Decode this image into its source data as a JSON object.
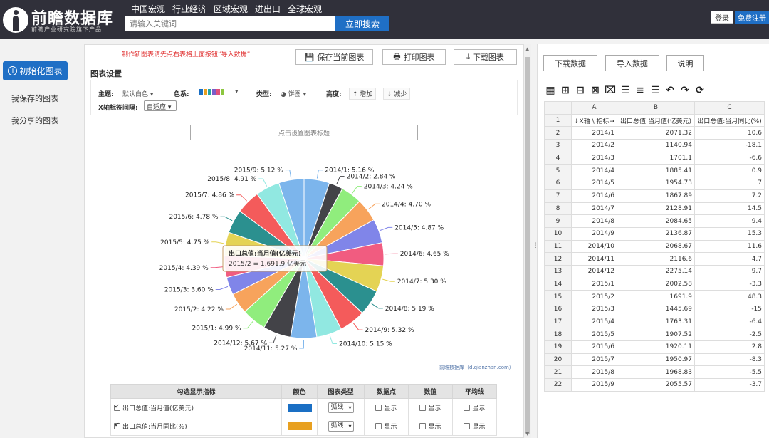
{
  "header": {
    "logo_title": "前瞻数据库",
    "logo_subtitle": "前瞻产业研究院旗下产品",
    "nav": [
      "中国宏观",
      "行业经济",
      "区域宏观",
      "进出口",
      "全球宏观"
    ],
    "search_placeholder": "请输入关键词",
    "search_button": "立即搜索",
    "login": "登录",
    "register": "免费注册"
  },
  "sidebar": {
    "init_button": "初始化图表",
    "items": [
      "我保存的图表",
      "我分享的图表"
    ]
  },
  "chart_panel": {
    "hint": "制作新图表请先点右表格上面按钮“导入数据”",
    "save_button": "保存当前图表",
    "print_button": "打印图表",
    "download_button": "下载图表",
    "settings_title": "图表设置",
    "theme_label": "主题:",
    "theme_value": "默认白色",
    "palette_label": "色系:",
    "palette": [
      "#1a6fc4",
      "#e8a020",
      "#22a3a3",
      "#7b5cc8",
      "#e0507a",
      "#8cc63f"
    ],
    "type_label": "类型:",
    "type_value": "饼图",
    "height_label": "高度:",
    "height_add": "增加",
    "height_reduce": "减少",
    "xaxis_label": "X轴标签间隔:",
    "xaxis_value": "自适应",
    "chart_title_button": "点击设置图表标题",
    "credit": "前瞻数据库（d.qianzhan.com）",
    "tooltip_title": "出口总值:当月值(亿美元)",
    "tooltip_value": "2015/2 = 1,691.9 亿美元"
  },
  "indicator_table": {
    "headers": [
      "勾选显示指标",
      "颜色",
      "图表类型",
      "数据点",
      "数值",
      "平均线"
    ],
    "rows": [
      {
        "name": "出口总值:当月值(亿美元)",
        "color": "#1a6fc4",
        "type": "弧线",
        "checked": true
      },
      {
        "name": "出口总值:当月同比(%)",
        "color": "#e8a020",
        "type": "弧线",
        "checked": true
      }
    ],
    "option_label": "显示"
  },
  "data_panel": {
    "download_button": "下载数据",
    "import_button": "导入数据",
    "help_button": "说明",
    "columns": [
      "A",
      "B",
      "C"
    ],
    "header_row": [
      "↓X轴 \\ 指标→",
      "出口总值:当月值(亿美元)",
      "出口总值:当月同比(%)"
    ],
    "rows": [
      [
        "2014/1",
        "2071.32",
        "10.6"
      ],
      [
        "2014/2",
        "1140.94",
        "-18.1"
      ],
      [
        "2014/3",
        "1701.1",
        "-6.6"
      ],
      [
        "2014/4",
        "1885.41",
        "0.9"
      ],
      [
        "2014/5",
        "1954.73",
        "7"
      ],
      [
        "2014/6",
        "1867.89",
        "7.2"
      ],
      [
        "2014/7",
        "2128.91",
        "14.5"
      ],
      [
        "2014/8",
        "2084.65",
        "9.4"
      ],
      [
        "2014/9",
        "2136.87",
        "15.3"
      ],
      [
        "2014/10",
        "2068.67",
        "11.6"
      ],
      [
        "2014/11",
        "2116.6",
        "4.7"
      ],
      [
        "2014/12",
        "2275.14",
        "9.7"
      ],
      [
        "2015/1",
        "2002.58",
        "-3.3"
      ],
      [
        "2015/2",
        "1691.9",
        "48.3"
      ],
      [
        "2015/3",
        "1445.69",
        "-15"
      ],
      [
        "2015/4",
        "1763.31",
        "-6.4"
      ],
      [
        "2015/5",
        "1907.52",
        "-2.5"
      ],
      [
        "2015/6",
        "1920.11",
        "2.8"
      ],
      [
        "2015/7",
        "1950.97",
        "-8.3"
      ],
      [
        "2015/8",
        "1968.83",
        "-5.5"
      ],
      [
        "2015/9",
        "2055.57",
        "-3.7"
      ]
    ]
  },
  "chart_data": {
    "type": "pie",
    "title": "",
    "series_name": "出口总值:当月值(亿美元)",
    "categories": [
      "2014/1",
      "2014/2",
      "2014/3",
      "2014/4",
      "2014/5",
      "2014/6",
      "2014/7",
      "2014/8",
      "2014/9",
      "2014/10",
      "2014/11",
      "2014/12",
      "2015/1",
      "2015/2",
      "2015/3",
      "2015/4",
      "2015/5",
      "2015/6",
      "2015/7",
      "2015/8",
      "2015/9"
    ],
    "values": [
      2071.32,
      1140.94,
      1701.1,
      1885.41,
      1954.73,
      1867.89,
      2128.91,
      2084.65,
      2136.87,
      2068.67,
      2116.6,
      2275.14,
      2002.58,
      1691.9,
      1445.69,
      1763.31,
      1907.52,
      1920.11,
      1950.97,
      1968.83,
      2055.57
    ],
    "percent_labels": [
      "2014/1: 5.16 %",
      "2014/2: 2.84 %",
      "2014/3: 4.24 %",
      "2014/4: 4.70 %",
      "2014/5: 4.87 %",
      "2014/6: 4.65 %",
      "2014/7: 5.30 %",
      "2014/8: 5.19 %",
      "2014/9: 5.32 %",
      "2014/10: 5.15 %",
      "2014/11: 5.27 %",
      "2014/12: 5.67 %",
      "2015/1: 4.99 %",
      "2015/2: 4.22 %",
      "2015/3: 3.60 %",
      "2015/4: 4.39 %",
      "2015/5: 4.75 %",
      "2015/6: 4.78 %",
      "2015/7: 4.86 %",
      "2015/8: 4.91 %",
      "2015/9: 5.12 %"
    ],
    "colors": [
      "#7cb5ec",
      "#434348",
      "#90ed7d",
      "#f7a35c",
      "#8085e9",
      "#f15c80",
      "#e4d354",
      "#2b908f",
      "#f45b5b",
      "#91e8e1",
      "#7cb5ec",
      "#434348",
      "#90ed7d",
      "#f7a35c",
      "#8085e9",
      "#f15c80",
      "#e4d354",
      "#2b908f",
      "#f45b5b",
      "#91e8e1",
      "#7cb5ec"
    ]
  }
}
